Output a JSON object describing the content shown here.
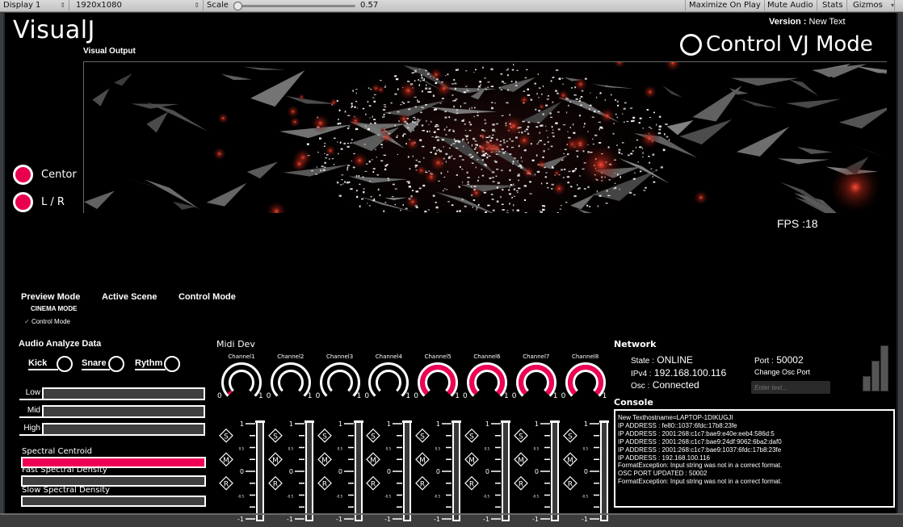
{
  "toolbar": {
    "display": "Display 1",
    "resolution": "1920x1080",
    "scale_label": "Scale",
    "scale_value": "0.57",
    "scale_fraction": 0.0,
    "buttons": [
      "Maximize On Play",
      "Mute Audio",
      "Stats",
      "Gizmos"
    ]
  },
  "header": {
    "title": "VisualJ",
    "visual_output_label": "Visual Output",
    "version_label": "Version :",
    "version_value": "New Text",
    "vj_mode_label": "Control VJ Mode"
  },
  "output": {
    "fps": "FPS :18"
  },
  "view_options": [
    {
      "label": "Centor",
      "selected": true
    },
    {
      "label": "L / R",
      "selected": true
    }
  ],
  "modes": {
    "preview_mode": "Preview Mode",
    "active_scene": "Active Scene",
    "control_mode": "Control Mode",
    "cinema_mode": "CINEMA MODE",
    "control_mode_item": "Control Mode",
    "check_glyph": "✓"
  },
  "audio": {
    "title": "Audio Analyze Data",
    "beats": [
      "Kick",
      "Snare",
      "Rythm"
    ],
    "bands": [
      {
        "label": "Low",
        "level": 0
      },
      {
        "label": "Mid",
        "level": 0
      },
      {
        "label": "High",
        "level": 0
      }
    ],
    "spectral": [
      {
        "label": "Spectral Centroid",
        "level": 1.0
      },
      {
        "label": "Fast Spectral Density",
        "level": 0
      },
      {
        "label": "Slow Spectral Density",
        "level": 0
      }
    ],
    "accent_color": "#ef0056"
  },
  "midi": {
    "title": "Midi Dev",
    "knob_min": "0",
    "knob_max": "1",
    "fader_ticks": [
      "1",
      "0.5",
      "0",
      "-0.5",
      "-1"
    ],
    "buttons": [
      "S",
      "M",
      "R"
    ],
    "channels": [
      {
        "name": "Channel1",
        "knob": 0.03
      },
      {
        "name": "Channel2",
        "knob": 0
      },
      {
        "name": "Channel3",
        "knob": 0
      },
      {
        "name": "Channel4",
        "knob": 0
      },
      {
        "name": "Channel5",
        "knob": 1
      },
      {
        "name": "Channel6",
        "knob": 1
      },
      {
        "name": "Channel7",
        "knob": 1
      },
      {
        "name": "Channel8",
        "knob": 1
      }
    ]
  },
  "network": {
    "title": "Network",
    "state_label": "State :",
    "state_value": "ONLINE",
    "ipv4_label": "IPv4 :",
    "ipv4_value": "192.168.100.116",
    "osc_label": "Osc :",
    "osc_value": "Connected",
    "port_label": "Port :",
    "port_value": "50002",
    "change_port_label": "Change Osc Port",
    "port_input_placeholder": "Enter text...",
    "signal_bars": 3
  },
  "console": {
    "title": "Console",
    "lines": [
      "New Texthostname=LAPTOP-1DIKUGJI",
      "IP ADDRESS : fe80::1037:6fdc:17b8:23fe",
      "IP ADDRESS : 2001:268:c1c7:bae9:e40e:eeb4:586d:5",
      "IP ADDRESS : 2001:268:c1c7:bae9:24df:9062:6ba2:daf0",
      "IP ADDRESS : 2001:268:c1c7:bae9:1037:6fdc:17b8:23fe",
      "IP ADDRESS : 192.168.100.116",
      "FormatException: Input string was not in a correct format.",
      "OSC PORT UPDATED : 50002",
      "FormatException: Input string was not in a correct format."
    ]
  }
}
